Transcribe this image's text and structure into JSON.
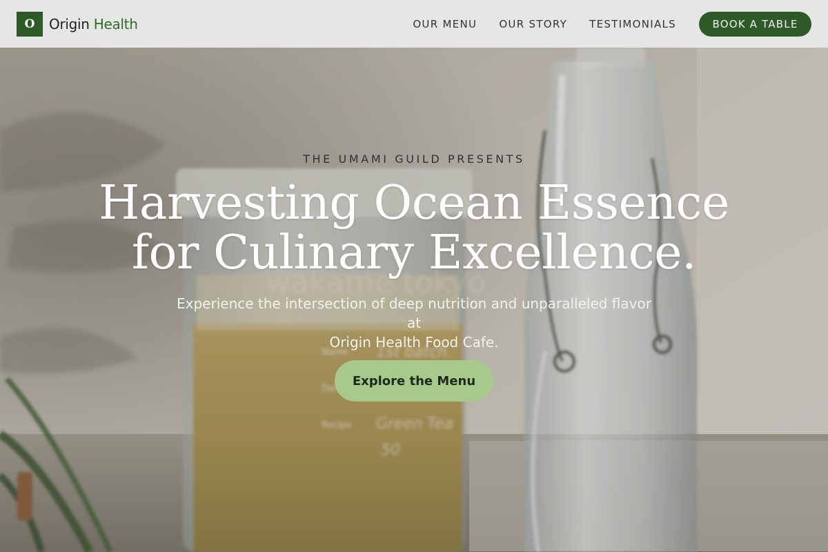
{
  "header": {
    "brand_mark": "O",
    "brand_part1": "Origin",
    "brand_part2": "Health",
    "nav": [
      {
        "label": "OUR MENU"
      },
      {
        "label": "OUR STORY"
      },
      {
        "label": "TESTIMONIALS"
      }
    ],
    "cta_label": "BOOK A TABLE"
  },
  "hero": {
    "kicker": "THE UMAMI GUILD PRESENTS",
    "headline_line1": "Harvesting Ocean Essence",
    "headline_line2": "for Culinary Excellence.",
    "subtitle_line1": "Experience the intersection of deep nutrition and unparalleled flavor at",
    "subtitle_line2": "Origin Health Food Cafe.",
    "cta_label": "Explore the Menu",
    "background": {
      "description_icon": "jar-and-bottle-photo",
      "jar_label_text": "wakame tokyo",
      "jar_fields": [
        "Name",
        "Date",
        "Recipe"
      ],
      "jar_handwriting": [
        "1st batch",
        "Green Tea",
        "50"
      ]
    }
  },
  "colors": {
    "brand_green": "#2e5a27",
    "cta_light_green": "#a7c98c",
    "header_bg": "#e6e6e6"
  }
}
